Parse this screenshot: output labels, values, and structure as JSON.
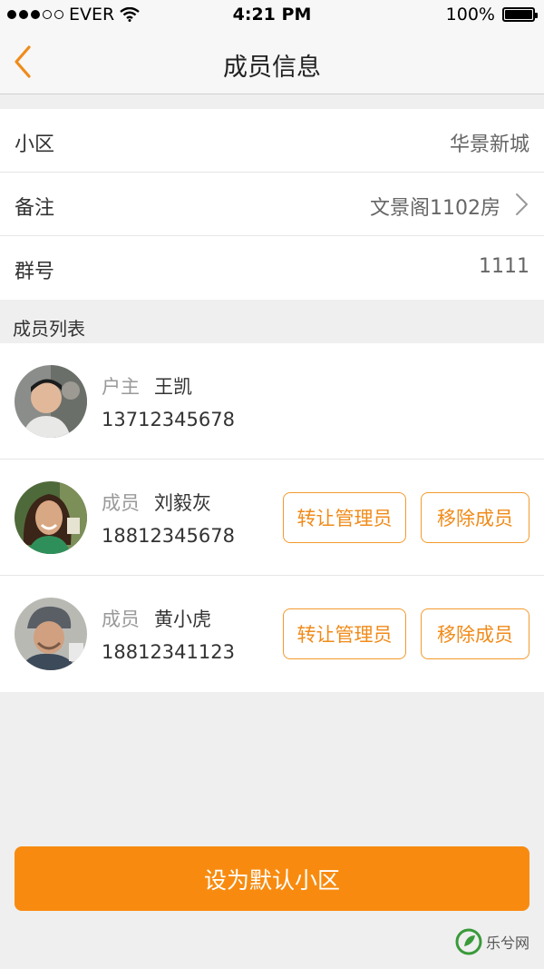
{
  "status_bar": {
    "carrier": "EVER",
    "time": "4:21 PM",
    "battery": "100%",
    "signal_filled": 3,
    "signal_total": 5
  },
  "nav": {
    "title": "成员信息",
    "back_icon": "chevron-left-icon",
    "accent_color": "#f08b1a"
  },
  "info": {
    "rows": [
      {
        "label": "小区",
        "value": "华景新城"
      },
      {
        "label": "备注",
        "value": "文景阁1102房"
      },
      {
        "label": "群号",
        "value": "1111"
      }
    ]
  },
  "members": {
    "section_title": "成员列表",
    "items": [
      {
        "role": "户主",
        "name": "王凯",
        "phone": "13712345678"
      },
      {
        "role": "成员",
        "name": "刘毅灰",
        "phone": "18812345678",
        "transfer_label": "转让管理员",
        "remove_label": "移除成员"
      },
      {
        "role": "成员",
        "name": "黄小虎",
        "phone": "18812341123",
        "transfer_label": "转让管理员",
        "remove_label": "移除成员"
      }
    ]
  },
  "footer": {
    "primary_button": "设为默认小区",
    "primary_color": "#f88b0f"
  },
  "watermark": {
    "text": "乐兮网"
  }
}
